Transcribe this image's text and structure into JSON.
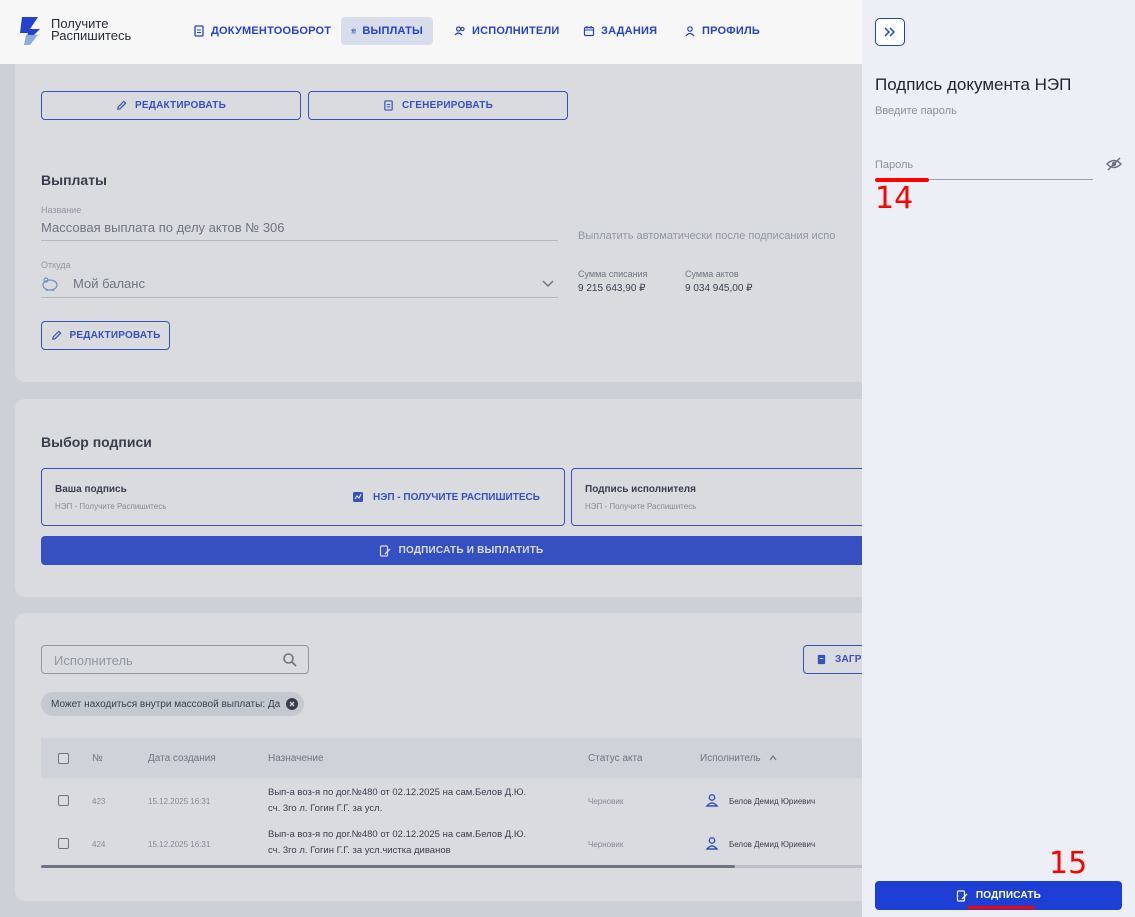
{
  "brand": {
    "line1": "Получите",
    "line2": "Распишитесь"
  },
  "nav": {
    "docs": "ДОКУМЕНТООБОРОТ",
    "payments": "ВЫПЛАТЫ",
    "executors": "ИСПОЛНИТЕЛИ",
    "tasks": "ЗАДАНИЯ",
    "profile": "ПРОФИЛЬ"
  },
  "top_actions": {
    "edit": "РЕДАКТИРОВАТЬ",
    "generate": "СГЕНЕРИРОВАТЬ"
  },
  "payout": {
    "title": "Выплаты",
    "name_label": "Название",
    "name_value": "Массовая выплата по делу актов № 306",
    "auto_text": "Выплатить автоматически после подписания испо",
    "source_label": "Откуда",
    "source_value": "Мой баланс",
    "debit_label": "Сумма списания",
    "debit_value": "9 215 643,90 ₽",
    "acts_label": "Сумма актов",
    "acts_value": "9 034 945,00 ₽",
    "edit": "РЕДАКТИРОВАТЬ"
  },
  "signature": {
    "title": "Выбор подписи",
    "yours_title": "Ваша подпись",
    "yours_sub": "НЭП - Получите Распишитесь",
    "yours_action": "НЭП - ПОЛУЧИТЕ РАСПИШИТЕСЬ",
    "exec_title": "Подпись исполнителя",
    "exec_sub": "НЭП - Получите Распишитесь",
    "sign_pay": "ПОДПИСАТЬ И ВЫПЛАТИТЬ"
  },
  "table": {
    "search_placeholder": "Исполнитель",
    "upload": "ЗАГРУ",
    "filter_chip": "Может находиться внутри массовой выплаты: Да",
    "headers": {
      "num": "№",
      "date": "Дата создания",
      "purpose": "Назначение",
      "status": "Статус акта",
      "executor": "Исполнитель"
    },
    "rows": [
      {
        "num": "423",
        "date": "15.12.2025 16:31",
        "purpose1": "Вып-а воз-я по дог.№480 от 02.12.2025 на сам.Белов Д.Ю.",
        "purpose2": "сч. 3го л. Гогин Г.Г. за усл.",
        "status": "Черновик",
        "executor": "Белов Демид Юриевич"
      },
      {
        "num": "424",
        "date": "15.12.2025 16:31",
        "purpose1": "Вып-а воз-я по дог.№480 от 02.12.2025 на сам.Белов Д.Ю.",
        "purpose2": "сч. 3го л. Гогин Г.Г. за усл.чистка диванов",
        "status": "Черновик",
        "executor": "Белов Демид Юриевич"
      }
    ]
  },
  "panel": {
    "title": "Подпись документа НЭП",
    "subtitle": "Введите пароль",
    "password_placeholder": "Пароль",
    "sign": "ПОДПИСАТЬ"
  },
  "annotations": {
    "a14": "14",
    "a15": "15"
  },
  "colors": {
    "accent": "#1e3fd6",
    "annotation": "#ff0000"
  }
}
